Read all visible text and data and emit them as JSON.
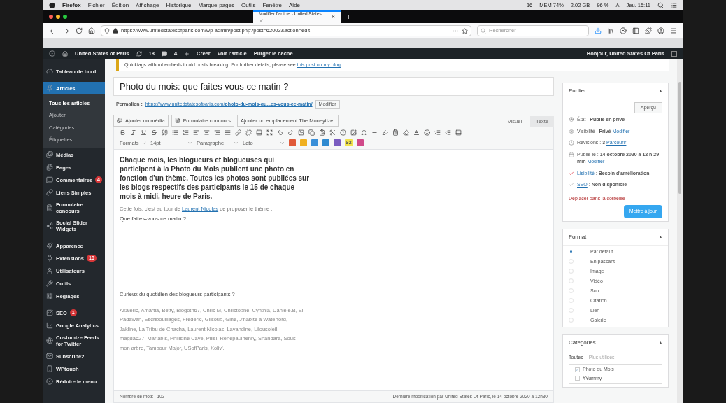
{
  "mac_menu": {
    "app": "Firefox",
    "items": [
      "Fichier",
      "Édition",
      "Affichage",
      "Historique",
      "Marque-pages",
      "Outils",
      "Fenêtre",
      "Aide"
    ],
    "status": [
      "16",
      "MEM 74%",
      "2.02 GB",
      "96 %",
      "A",
      "Jeu. 15:11"
    ]
  },
  "browser": {
    "tab_title": "Modifier l'article ‹ United States of",
    "tab_close": "×",
    "new_tab": "+",
    "url": "https://www.unitedstatesofparis.com/wp-admin/post.php?post=62003&action=edit",
    "search_placeholder": "Rechercher"
  },
  "admin_bar": {
    "site": "United States of Paris",
    "updates": "18",
    "comments": "4",
    "create": "Créer",
    "view": "Voir l'article",
    "purge": "Purger le cache",
    "greeting": "Bonjour, United States Of Paris"
  },
  "notice": [
    {
      "kind": "plain",
      "text": "Quicktags without embeds in old posts breaking. For further details, please see "
    },
    {
      "kind": "link",
      "text": "this post on my blog"
    },
    {
      "kind": "plain",
      "text": "."
    }
  ],
  "sidebar": {
    "groups": [
      [
        {
          "label": "Tableau de bord",
          "selected": false
        }
      ],
      [
        {
          "label": "Articles",
          "selected": true,
          "expanded": true,
          "children": [
            {
              "label": "Tous les articles",
              "selected": true
            },
            {
              "label": "Ajouter",
              "selected": false
            },
            {
              "label": "Catégories",
              "selected": false
            },
            {
              "label": "Étiquettes",
              "selected": false
            }
          ]
        },
        {
          "label": "Médias",
          "selected": false
        },
        {
          "label": "Pages",
          "selected": false
        },
        {
          "label": "Commentaires",
          "selected": false,
          "badge": "4"
        },
        {
          "label": "Liens Simples",
          "selected": false
        },
        {
          "label": "Formulaire concours",
          "selected": false
        },
        {
          "label": "Social Slider Widgets",
          "selected": false
        }
      ],
      [
        {
          "label": "Apparence",
          "selected": false
        },
        {
          "label": "Extensions",
          "selected": false,
          "badge": "15"
        },
        {
          "label": "Utilisateurs",
          "selected": false
        },
        {
          "label": "Outils",
          "selected": false
        },
        {
          "label": "Réglages",
          "selected": false
        }
      ],
      [
        {
          "label": "SEO",
          "selected": false,
          "badge": "1"
        },
        {
          "label": "Google Analytics",
          "selected": false
        },
        {
          "label": "Customize Feeds for Twitter",
          "selected": false
        },
        {
          "label": "Subscribe2",
          "selected": false
        },
        {
          "label": "WPtouch",
          "selected": false
        },
        {
          "label": "Réduire le menu",
          "selected": false
        }
      ]
    ]
  },
  "post": {
    "title": "Photo du mois: que faites vous ce matin ?",
    "permalink_label": "Permalien :",
    "permalink_base": "https://www.unitedstatesofparis.com/",
    "permalink_slug": "photo-du-mois-qu...es-vous-ce-matin/",
    "permalink_button": "Modifier"
  },
  "media_buttons": [
    "Ajouter un média",
    "Formulaire concours",
    "Ajouter un emplacement The Moneytizer"
  ],
  "editor_tabs": [
    {
      "label": "Visuel",
      "selected": true
    },
    {
      "label": "Texte",
      "selected": false
    }
  ],
  "format_selects": [
    "Formats",
    "14pt",
    "Paragraphe",
    "Lato"
  ],
  "plugin_badge": "S2",
  "content": {
    "lead": "Chaque mois, les blogueurs et blogueuses qui participent à la Photo du Mois publient une photo en fonction d'un thème. Toutes les photos sont publiées sur les blogs respectifs des participants le 15 de chaque mois à midi, heure de Paris.",
    "intro": [
      {
        "kind": "plain",
        "text": "Cette fois, c'est au tour de "
      },
      {
        "kind": "link",
        "text": "Laurent Nicolas"
      },
      {
        "kind": "plain",
        "text": " de proposer le thème :"
      }
    ],
    "theme": "Que faites-vous ce matin ?",
    "question": "Curieux du quotidien des blogueurs participants ?",
    "participants": "Akaieric, Amartia, Betty, Blogoth67, Chris M, Christophe, Cynthia, Danièle.B, El Padawan, Escribouillages, Frédéric, Gilsoub, Gine, J'habite à Waterford, Jakline, La Tribu de Chacha, Laurent Nicolas, Lavandine, Lilousoleil, magda627, Marlabis, Philisine Cave, Pilisi, Renepaulhenry, Shandara, Sous mon arbre, Tambour Major, USofParis, Xoliv'."
  },
  "footer": {
    "word_count": "Nombre de mots : 103",
    "last_modified": "Dernière modification par United States Of Paris, le 14 octobre 2020 à 12h30"
  },
  "publish": {
    "title": "Publier",
    "toggle": "▲",
    "preview": "Aperçu",
    "rows": [
      {
        "parts": [
          {
            "kind": "plain",
            "text": "État : "
          },
          {
            "kind": "bold",
            "text": "Publié en privé"
          }
        ]
      },
      {
        "parts": [
          {
            "kind": "plain",
            "text": "Visibilité : "
          },
          {
            "kind": "bold",
            "text": "Privé "
          },
          {
            "kind": "link",
            "text": "Modifier"
          }
        ]
      },
      {
        "parts": [
          {
            "kind": "plain",
            "text": "Révisions : "
          },
          {
            "kind": "bold",
            "text": "3 "
          },
          {
            "kind": "link",
            "text": "Parcourir"
          }
        ]
      },
      {
        "parts": [
          {
            "kind": "plain",
            "text": "Publié le : "
          },
          {
            "kind": "bold",
            "text": "14 octobre 2020 à 12 h 29 min "
          },
          {
            "kind": "link",
            "text": "Modifier"
          }
        ]
      },
      {
        "parts": [
          {
            "kind": "link",
            "text": "Lisibilité"
          },
          {
            "kind": "plain",
            "text": " : "
          },
          {
            "kind": "bold",
            "text": "Besoin d'amélioration"
          }
        ]
      },
      {
        "parts": [
          {
            "kind": "link",
            "text": "SEO"
          },
          {
            "kind": "plain",
            "text": " : "
          },
          {
            "kind": "bold",
            "text": "Non disponible"
          }
        ]
      }
    ],
    "trash": "Déplacer dans la corbeille",
    "update": "Mettre à jour"
  },
  "format_box": {
    "title": "Format",
    "toggle": "▲",
    "options": [
      {
        "label": "Par défaut",
        "selected": true
      },
      {
        "label": "En passant",
        "selected": false
      },
      {
        "label": "Image",
        "selected": false
      },
      {
        "label": "Vidéo",
        "selected": false
      },
      {
        "label": "Son",
        "selected": false
      },
      {
        "label": "Citation",
        "selected": false
      },
      {
        "label": "Lien",
        "selected": false
      },
      {
        "label": "Galerie",
        "selected": false
      }
    ]
  },
  "categories": {
    "title": "Catégories",
    "toggle": "▲",
    "tabs": [
      {
        "label": "Toutes",
        "selected": true
      },
      {
        "label": "Plus utilisés",
        "selected": false
      }
    ],
    "items": [
      {
        "label": "Photo du Mois",
        "checked": true
      },
      {
        "label": "#Yummy",
        "checked": false
      }
    ]
  }
}
